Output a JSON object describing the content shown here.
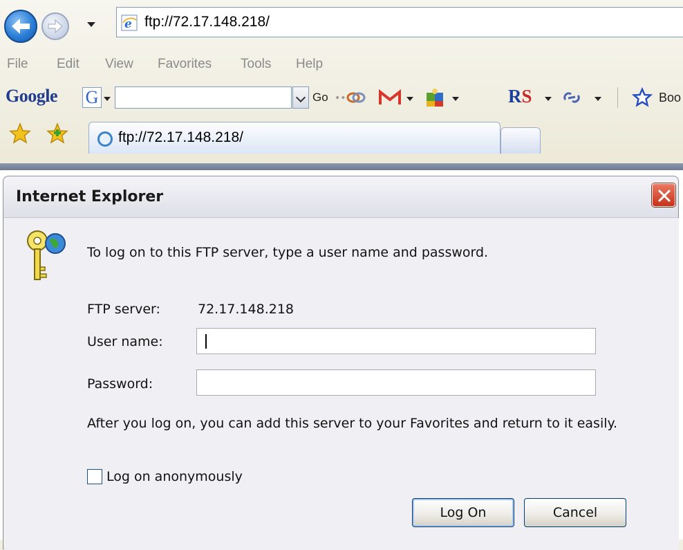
{
  "browser": {
    "address_url": "ftp://72.17.148.218/",
    "menu": [
      "File",
      "Edit",
      "View",
      "Favorites",
      "Tools",
      "Help"
    ],
    "google_toolbar": {
      "logo": "Google",
      "g_button": "G",
      "go_label": "Go",
      "rs_label": "RS",
      "bookmarks_label": "Boo"
    },
    "tab": {
      "title": "ftp://72.17.148.218/"
    }
  },
  "dialog": {
    "title": "Internet Explorer",
    "intro": "To log on to this FTP server, type a user name and password.",
    "server_label": "FTP server:",
    "server_value": "72.17.148.218",
    "username_label": "User name:",
    "username_value": "",
    "password_label": "Password:",
    "password_value": "",
    "note": "After you log on, you can add this server to your Favorites and return to it easily.",
    "anonymous_label": "Log on anonymously",
    "anonymous_checked": false,
    "log_on_button": "Log On",
    "cancel_button": "Cancel"
  },
  "colors": {
    "chrome_bg": "#ece9d8",
    "dialog_bg": "#f0f0f4",
    "close_red": "#c6321b",
    "accent_blue": "#2b7fd6"
  },
  "icons": [
    "back-arrow-icon",
    "forward-arrow-icon",
    "ie-page-icon",
    "envelope-m-icon",
    "puzzle-icon",
    "chain-link-icon",
    "star-outline-icon",
    "favorites-star-icon",
    "add-favorite-icon",
    "keys-icon",
    "close-x-icon"
  ]
}
